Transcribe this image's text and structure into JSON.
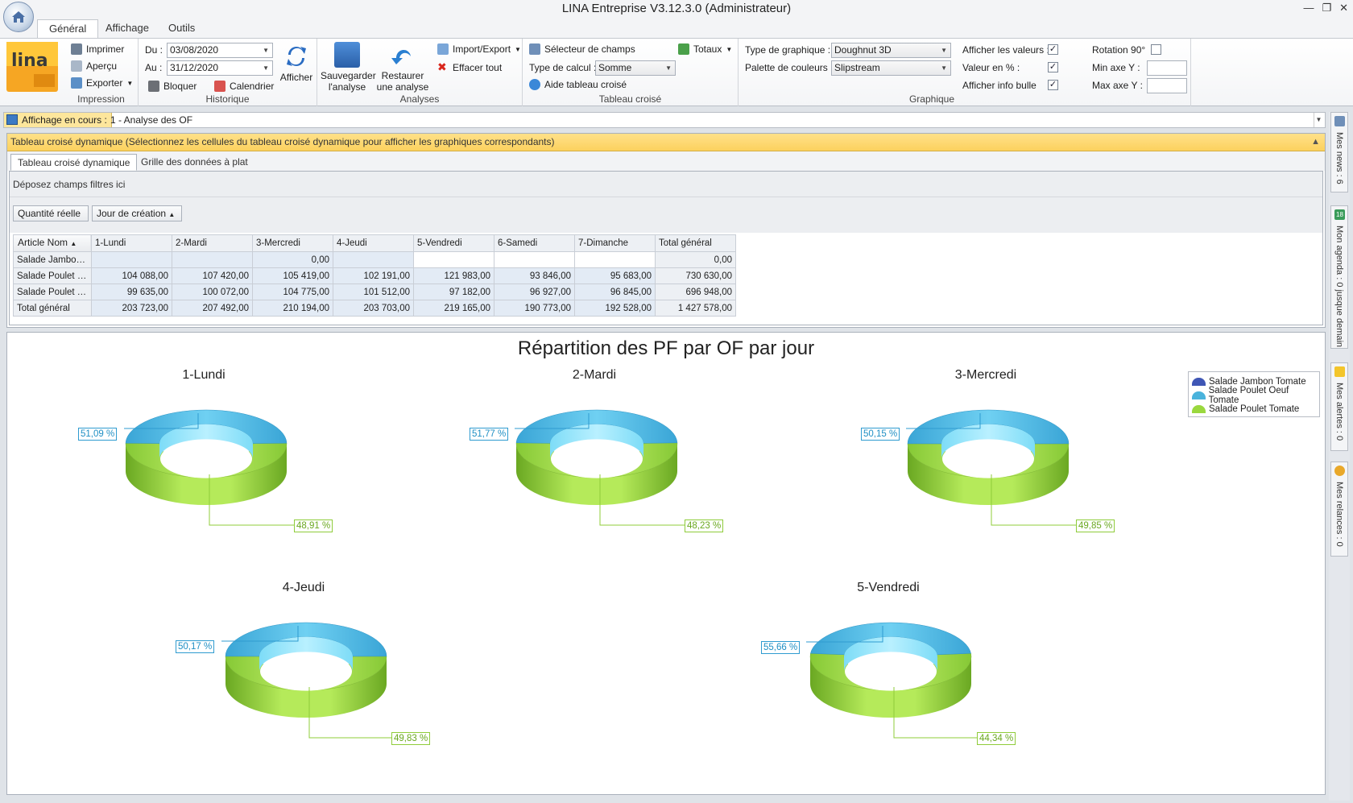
{
  "window": {
    "title": "LINA Entreprise  V3.12.3.0  (Administrateur)"
  },
  "ribbon": {
    "tabs": [
      "Général",
      "Affichage",
      "Outils"
    ],
    "groups": {
      "impression": {
        "name": "Impression",
        "print": "Imprimer",
        "preview": "Aperçu",
        "export": "Exporter"
      },
      "historique": {
        "name": "Historique",
        "du_label": "Du :",
        "du_value": "03/08/2020",
        "au_label": "Au :",
        "au_value": "31/12/2020",
        "lock": "Bloquer",
        "calendar": "Calendrier",
        "show": "Afficher"
      },
      "analyses": {
        "name": "Analyses",
        "save": "Sauvegarder\nl'analyse",
        "restore": "Restaurer\nune analyse",
        "import_export": "Import/Export",
        "clear_all": "Effacer tout"
      },
      "tableau": {
        "name": "Tableau croisé",
        "field_selector": "Sélecteur de champs",
        "totals": "Totaux",
        "calc_type_label": "Type de calcul :",
        "calc_type_value": "Somme",
        "help": "Aide tableau croisé"
      },
      "graphique": {
        "name": "Graphique",
        "chart_type_label": "Type de graphique :",
        "chart_type_value": "Doughnut 3D",
        "palette_label": "Palette de couleurs :",
        "palette_value": "Slipstream",
        "show_values": "Afficher les valeurs :",
        "values_pct": "Valeur en % :",
        "show_tooltip": "Afficher info bulle",
        "rotation": "Rotation 90°",
        "min_y": "Min axe Y :",
        "max_y": "Max axe Y :"
      }
    }
  },
  "view": {
    "label": "Affichage en cours :",
    "value": "1 - Analyse des OF"
  },
  "side_tabs": [
    "Mes news : 6",
    "Mon agenda : 0 jusque demain",
    "Mes alertes : 0",
    "Mes relances : 0"
  ],
  "side_icon_text": "18",
  "pivot": {
    "header": "Tableau croisé dynamique (Sélectionnez les cellules du tableau croisé dynamique pour afficher les graphiques correspondants)",
    "tabs": [
      "Tableau croisé dynamique",
      "Grille des données à plat"
    ],
    "filter_zone": "Déposez champs filtres ici",
    "data_field": "Quantité réelle",
    "column_field": "Jour de création",
    "row_field": "Article Nom",
    "columns": [
      "1-Lundi",
      "2-Mardi",
      "3-Mercredi",
      "4-Jeudi",
      "5-Vendredi",
      "6-Samedi",
      "7-Dimanche",
      "Total général"
    ],
    "rows": [
      {
        "name": "Salade Jambon ...",
        "values": [
          "",
          "",
          "0,00",
          "",
          "",
          "",
          "",
          "0,00"
        ]
      },
      {
        "name": "Salade Poulet O...",
        "values": [
          "104 088,00",
          "107 420,00",
          "105 419,00",
          "102 191,00",
          "121 983,00",
          "93 846,00",
          "95 683,00",
          "730 630,00"
        ]
      },
      {
        "name": "Salade Poulet To...",
        "values": [
          "99 635,00",
          "100 072,00",
          "104 775,00",
          "101 512,00",
          "97 182,00",
          "96 927,00",
          "96 845,00",
          "696 948,00"
        ]
      },
      {
        "name": "Total général",
        "values": [
          "203 723,00",
          "207 492,00",
          "210 194,00",
          "203 703,00",
          "219 165,00",
          "190 773,00",
          "192 528,00",
          "1 427 578,00"
        ]
      }
    ]
  },
  "chart": {
    "title": "Répartition des PF par OF par jour",
    "legend": [
      "Salade Jambon Tomate",
      "Salade Poulet Oeuf Tomate",
      "Salade Poulet Tomate"
    ],
    "colors": {
      "jambon": "#3f56b5",
      "oeuf": "#4ab3dc",
      "poulet": "#9ad83e"
    },
    "pies": [
      {
        "day": "1-Lundi",
        "oeuf_pct": "51,09 %",
        "poulet_pct": "48,91 %"
      },
      {
        "day": "2-Mardi",
        "oeuf_pct": "51,77 %",
        "poulet_pct": "48,23 %"
      },
      {
        "day": "3-Mercredi",
        "oeuf_pct": "50,15 %",
        "poulet_pct": "49,85 %"
      },
      {
        "day": "4-Jeudi",
        "oeuf_pct": "50,17 %",
        "poulet_pct": "49,83 %"
      },
      {
        "day": "5-Vendredi",
        "oeuf_pct": "55,66 %",
        "poulet_pct": "44,34 %"
      }
    ]
  },
  "chart_data": [
    {
      "type": "pie",
      "title": "1-Lundi",
      "categories": [
        "Salade Jambon Tomate",
        "Salade Poulet Oeuf Tomate",
        "Salade Poulet Tomate"
      ],
      "values": [
        0,
        51.09,
        48.91
      ]
    },
    {
      "type": "pie",
      "title": "2-Mardi",
      "categories": [
        "Salade Jambon Tomate",
        "Salade Poulet Oeuf Tomate",
        "Salade Poulet Tomate"
      ],
      "values": [
        0,
        51.77,
        48.23
      ]
    },
    {
      "type": "pie",
      "title": "3-Mercredi",
      "categories": [
        "Salade Jambon Tomate",
        "Salade Poulet Oeuf Tomate",
        "Salade Poulet Tomate"
      ],
      "values": [
        0,
        50.15,
        49.85
      ]
    },
    {
      "type": "pie",
      "title": "4-Jeudi",
      "categories": [
        "Salade Jambon Tomate",
        "Salade Poulet Oeuf Tomate",
        "Salade Poulet Tomate"
      ],
      "values": [
        0,
        50.17,
        49.83
      ]
    },
    {
      "type": "pie",
      "title": "5-Vendredi",
      "categories": [
        "Salade Jambon Tomate",
        "Salade Poulet Oeuf Tomate",
        "Salade Poulet Tomate"
      ],
      "values": [
        0,
        55.66,
        44.34
      ]
    }
  ]
}
